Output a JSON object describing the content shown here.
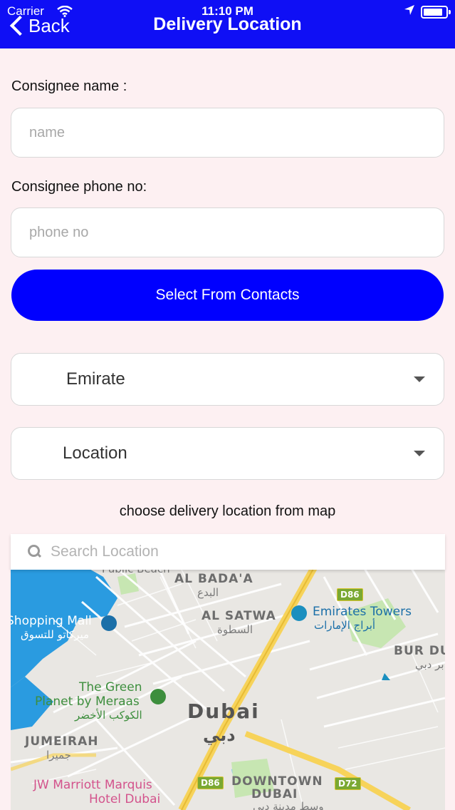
{
  "status_bar": {
    "carrier": "Carrier",
    "time": "11:10 PM"
  },
  "nav": {
    "back_label": "Back",
    "title": "Delivery Location"
  },
  "form": {
    "consignee_name_label": "Consignee name :",
    "consignee_name_placeholder": "name",
    "consignee_phone_label": "Consignee phone no:",
    "consignee_phone_placeholder": "phone no",
    "select_contacts_label": "Select From Contacts",
    "emirate_value": "Emirate",
    "location_value": "Location",
    "map_hint": "choose delivery location from map"
  },
  "map": {
    "search_placeholder": "Search Location",
    "labels": {
      "public_beach": "Public Beach",
      "al_badaa": "AL BADA'A",
      "al_badaa_ar": "البدع",
      "al_satwa": "AL SATWA",
      "al_satwa_ar": "السطوة",
      "emirates_towers": "Emirates Towers",
      "emirates_towers_ar": "أبراج الإمارات",
      "shopping_mall": "Shopping Mall",
      "shopping_mall_ar": "ميركاتو للتسوق",
      "bur_dubai": "BUR DU",
      "bur_dubai_ar": "بر دبي",
      "green_planet_1": "The Green",
      "green_planet_2": "Planet by Meraas",
      "green_planet_ar": "الكوكب الأخضر",
      "dubai": "Dubai",
      "dubai_ar": "دبي",
      "jumeirah": "JUMEIRAH",
      "jumeirah_ar": "جميرا",
      "jw_marriott_1": "JW Marriott Marquis",
      "jw_marriott_2": "Hotel Dubai",
      "downtown_1": "DOWNTOWN",
      "downtown_2": "DUBAI",
      "downtown_ar": "وسط مدينة دبي",
      "d86_a": "D86",
      "d86_b": "D86",
      "d72": "D72"
    },
    "colors": {
      "water": "#2a9be0",
      "road_major": "#f7d35a",
      "park": "#c7e6b2",
      "land": "#e9e7e3"
    }
  }
}
